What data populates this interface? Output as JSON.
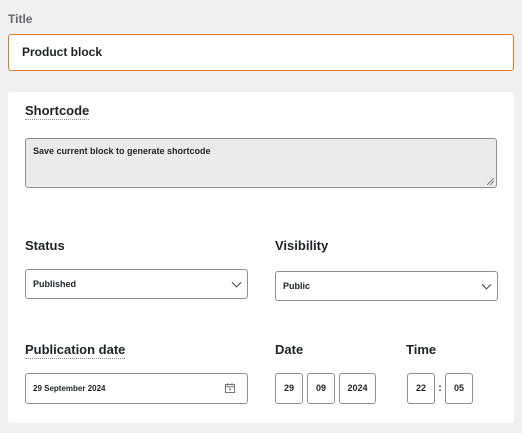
{
  "title": {
    "label": "Title",
    "value": "Product block"
  },
  "shortcode": {
    "label": "Shortcode",
    "placeholder": "Save current block to generate shortcode"
  },
  "status": {
    "label": "Status",
    "selected": "Published"
  },
  "visibility": {
    "label": "Visibility",
    "selected": "Public"
  },
  "publication_date": {
    "label": "Publication date",
    "value": "29 September 2024"
  },
  "date": {
    "label": "Date",
    "day": "29",
    "month": "09",
    "year": "2024"
  },
  "time": {
    "label": "Time",
    "hour": "22",
    "separator": ":",
    "minute": "05"
  },
  "colors": {
    "focus_border": "#e07a2e",
    "background": "#f0f0f1",
    "panel": "#ffffff"
  },
  "icons": {
    "select_arrow": "chevron-down-icon",
    "date_picker": "calendar-icon"
  }
}
